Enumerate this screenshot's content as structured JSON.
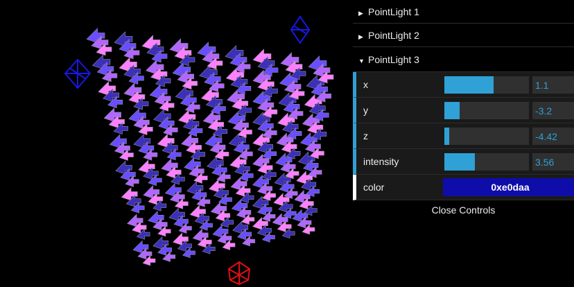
{
  "scene": {
    "grid_size": 9,
    "arrow_colors": [
      "#ff80ff",
      "#b266ff",
      "#6a4dff",
      "#3c2fb8"
    ],
    "helper_colors": {
      "light1": "#0000ff",
      "light2": "#0000ff",
      "light3": "#ff0000"
    }
  },
  "gui": {
    "folders": [
      {
        "title": "PointLight 1",
        "open": false
      },
      {
        "title": "PointLight 2",
        "open": false
      },
      {
        "title": "PointLight 3",
        "open": true
      }
    ],
    "controls": [
      {
        "label": "x",
        "value": "1.1",
        "fill": 0.58
      },
      {
        "label": "y",
        "value": "-3.2",
        "fill": 0.18
      },
      {
        "label": "z",
        "value": "-4.42",
        "fill": 0.06
      },
      {
        "label": "intensity",
        "value": "3.56",
        "fill": 0.36
      }
    ],
    "color": {
      "label": "color",
      "value": "0xe0daa",
      "swatch": "#0e0daa"
    },
    "close_label": "Close Controls",
    "accent": "#2fa1d6"
  }
}
